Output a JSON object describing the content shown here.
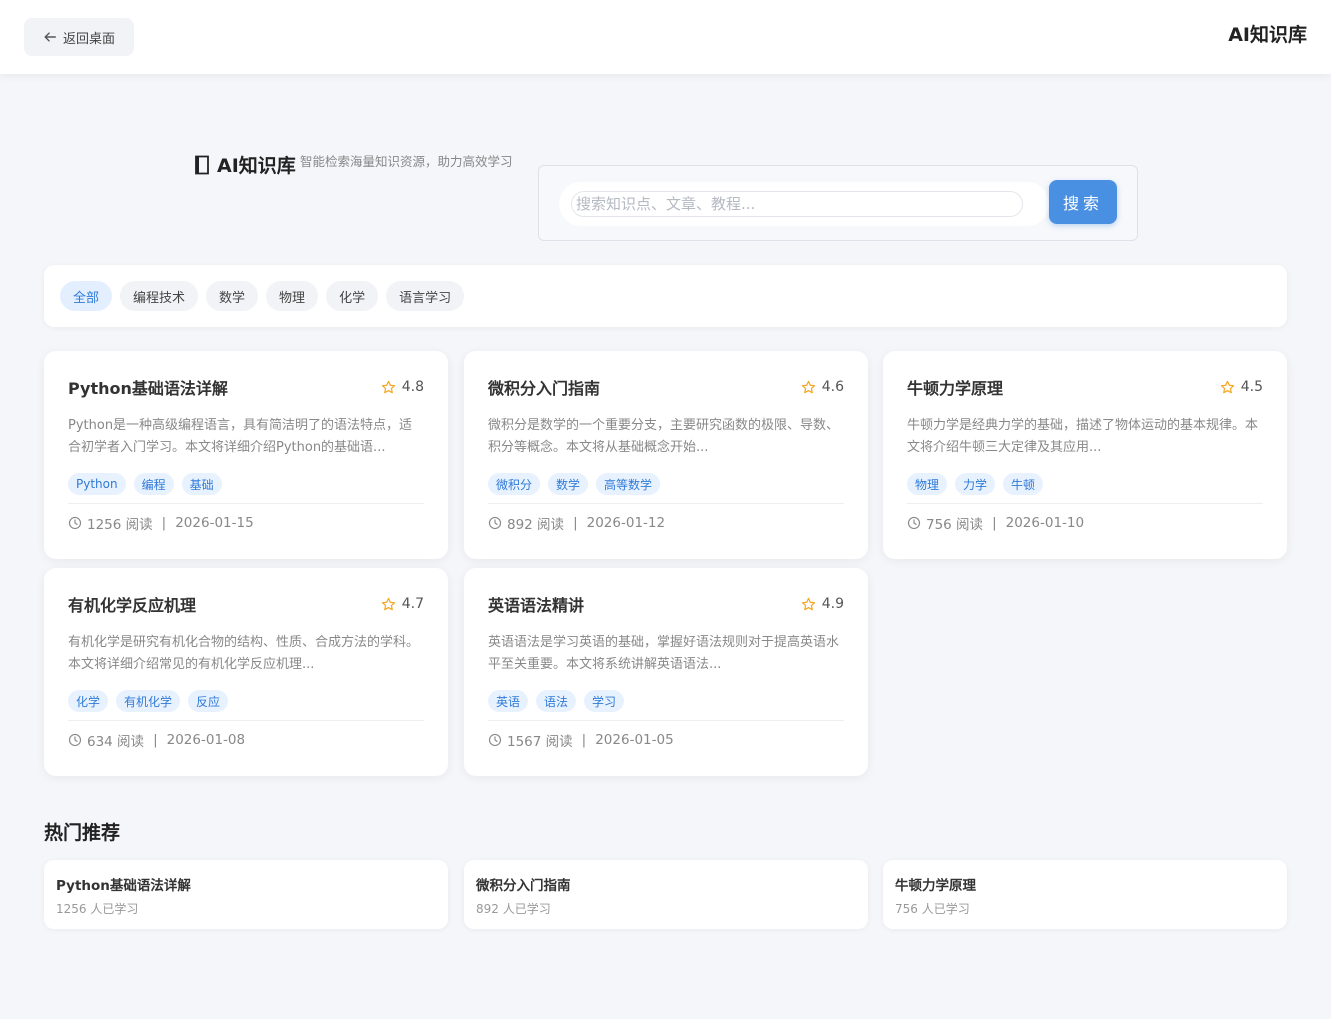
{
  "header": {
    "back_label": "返回桌面",
    "brand": "AI知识库"
  },
  "hero": {
    "title": "AI知识库",
    "subtitle": "智能检索海量知识资源，助力高效学习",
    "search_placeholder": "搜索知识点、文章、教程...",
    "search_value": "",
    "search_button": "搜索"
  },
  "filters": [
    "全部",
    "编程技术",
    "数学",
    "物理",
    "化学",
    "语言学习"
  ],
  "active_filter": "全部",
  "cards": [
    {
      "title": "Python基础语法详解",
      "rating": "4.8",
      "description": "Python是一种高级编程语言，具有简洁明了的语法特点，适合初学者入门学习。本文将详细介绍Python的基础语...",
      "tags": [
        "Python",
        "编程",
        "基础"
      ],
      "reads": "1256 阅读",
      "date": "2026-01-15"
    },
    {
      "title": "微积分入门指南",
      "rating": "4.6",
      "description": "微积分是数学的一个重要分支，主要研究函数的极限、导数、积分等概念。本文将从基础概念开始...",
      "tags": [
        "微积分",
        "数学",
        "高等数学"
      ],
      "reads": "892 阅读",
      "date": "2026-01-12"
    },
    {
      "title": "牛顿力学原理",
      "rating": "4.5",
      "description": "牛顿力学是经典力学的基础，描述了物体运动的基本规律。本文将介绍牛顿三大定律及其应用...",
      "tags": [
        "物理",
        "力学",
        "牛顿"
      ],
      "reads": "756 阅读",
      "date": "2026-01-10"
    },
    {
      "title": "有机化学反应机理",
      "rating": "4.7",
      "description": "有机化学是研究有机化合物的结构、性质、合成方法的学科。本文将详细介绍常见的有机化学反应机理...",
      "tags": [
        "化学",
        "有机化学",
        "反应"
      ],
      "reads": "634 阅读",
      "date": "2026-01-08"
    },
    {
      "title": "英语语法精讲",
      "rating": "4.9",
      "description": "英语语法是学习英语的基础，掌握好语法规则对于提高英语水平至关重要。本文将系统讲解英语语法...",
      "tags": [
        "英语",
        "语法",
        "学习"
      ],
      "reads": "1567 阅读",
      "date": "2026-01-05"
    }
  ],
  "meta_separator": "|",
  "hot": {
    "title": "热门推荐",
    "items": [
      {
        "name": "Python基础语法详解",
        "count": "1256 人已学习"
      },
      {
        "name": "微积分入门指南",
        "count": "892 人已学习"
      },
      {
        "name": "牛顿力学原理",
        "count": "756 人已学习"
      }
    ]
  },
  "colors": {
    "accent": "#4a90e2",
    "tag_bg": "#e8f2ff",
    "tag_text": "#2f7ad8",
    "star": "#f5a623",
    "page_bg": "#f5f6fa"
  },
  "icons": {
    "back": "arrow-left-icon",
    "book": "book-icon",
    "star": "star-outline-icon",
    "clock": "clock-icon"
  }
}
